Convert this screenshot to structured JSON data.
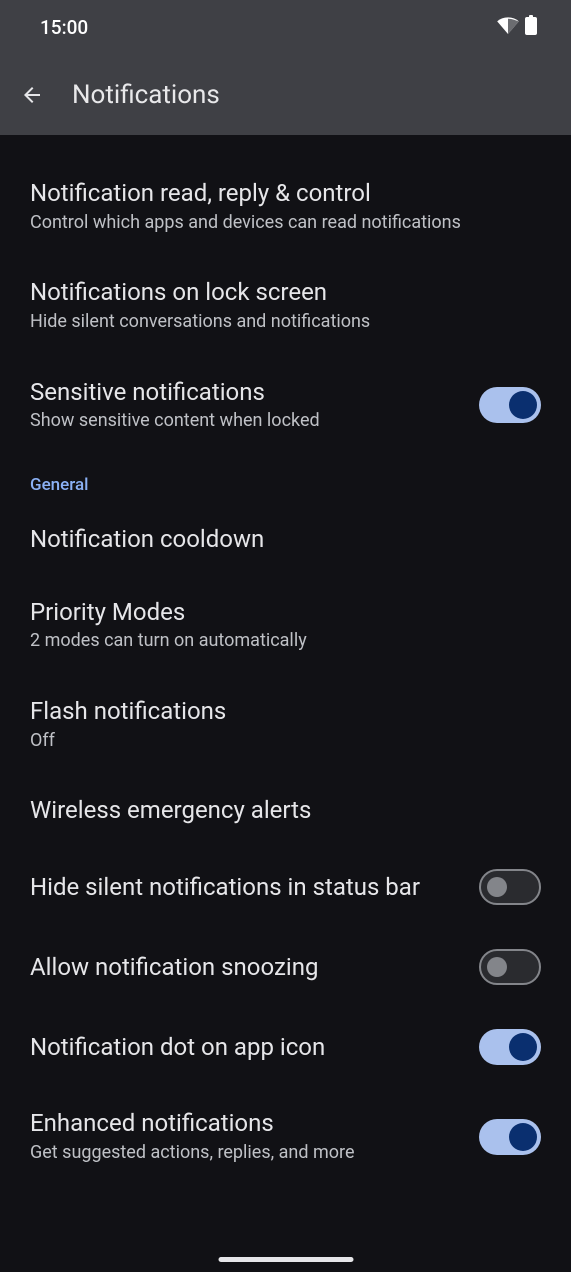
{
  "status": {
    "time": "15:00"
  },
  "header": {
    "title": "Notifications"
  },
  "items": {
    "read_reply": {
      "title": "Notification read, reply & control",
      "sub": "Control which apps and devices can read notifications"
    },
    "lock_screen": {
      "title": "Notifications on lock screen",
      "sub": "Hide silent conversations and notifications"
    },
    "sensitive": {
      "title": "Sensitive notifications",
      "sub": "Show sensitive content when locked"
    },
    "cooldown": {
      "title": "Notification cooldown"
    },
    "priority": {
      "title": "Priority Modes",
      "sub": "2 modes can turn on automatically"
    },
    "flash": {
      "title": "Flash notifications",
      "sub": "Off"
    },
    "wireless": {
      "title": "Wireless emergency alerts"
    },
    "hide_silent": {
      "title": "Hide silent notifications in status bar"
    },
    "snoozing": {
      "title": "Allow notification snoozing"
    },
    "dot": {
      "title": "Notification dot on app icon"
    },
    "enhanced": {
      "title": "Enhanced notifications",
      "sub": "Get suggested actions, replies, and more"
    }
  },
  "sections": {
    "general": "General"
  }
}
